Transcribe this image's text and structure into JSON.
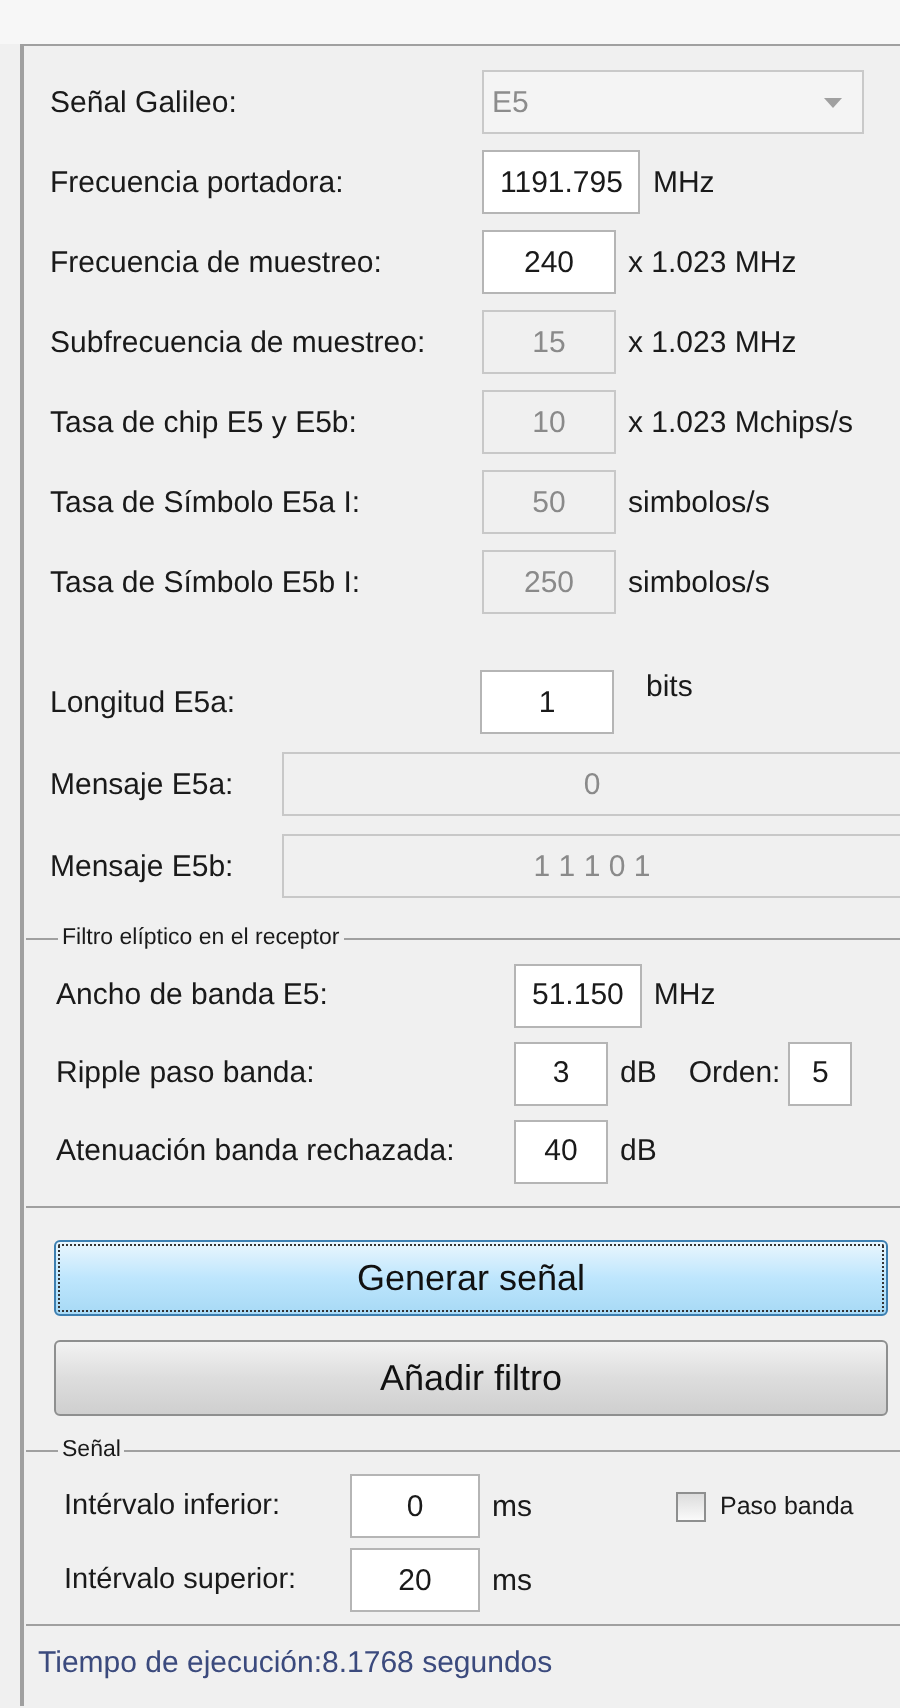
{
  "signal_select": {
    "label": "Señal Galileo:",
    "value": "E5",
    "disabled": true
  },
  "parameters": [
    {
      "label": "Frecuencia portadora:",
      "value": "1191.795",
      "unit": "MHz",
      "disabled": false
    },
    {
      "label": "Frecuencia de muestreo:",
      "value": "240",
      "unit": "x 1.023 MHz",
      "disabled": false
    },
    {
      "label": "Subfrecuencia de muestreo:",
      "value": "15",
      "unit": "x 1.023 MHz",
      "disabled": true
    },
    {
      "label": "Tasa de chip E5 y E5b:",
      "value": "10",
      "unit": "x 1.023 Mchips/s",
      "disabled": true
    },
    {
      "label": "Tasa de Símbolo E5a I:",
      "value": "50",
      "unit": "simbolos/s",
      "disabled": true
    },
    {
      "label": "Tasa de Símbolo E5b I:",
      "value": "250",
      "unit": "simbolos/s",
      "disabled": true
    }
  ],
  "message_fields": [
    {
      "kind": "short",
      "label": "Longitud E5a:",
      "value": "1",
      "unit": "bits",
      "disabled": false
    },
    {
      "kind": "wide",
      "label": "Mensaje E5a:",
      "value": "0",
      "disabled": true
    },
    {
      "kind": "wide",
      "label": "Mensaje E5b:",
      "value": "1 1 1 0 1",
      "disabled": true
    }
  ],
  "filter_group": {
    "title": "Filtro elíptico en el receptor",
    "fields": [
      {
        "label": "Ancho de banda E5:",
        "value": "51.150",
        "unit": "MHz"
      },
      {
        "label": "Ripple paso banda:",
        "value": "3",
        "unit": "dB",
        "extra": {
          "label": "Orden:",
          "value": "5"
        }
      },
      {
        "label": "Atenuación banda rechazada:",
        "value": "40",
        "unit": "dB"
      }
    ]
  },
  "buttons": [
    {
      "label": "Generar señal",
      "focused": true
    },
    {
      "label": "Añadir filtro",
      "focused": false
    }
  ],
  "signal_group": {
    "title": "Señal",
    "fields": [
      {
        "label": "Intérvalo inferior:",
        "value": "0",
        "unit": "ms"
      },
      {
        "label": "Intérvalo superior:",
        "value": "20",
        "unit": "ms"
      }
    ],
    "checkbox": {
      "label": "Paso banda",
      "checked": false
    }
  },
  "status": "Tiempo de ejecución:8.1768 segundos"
}
